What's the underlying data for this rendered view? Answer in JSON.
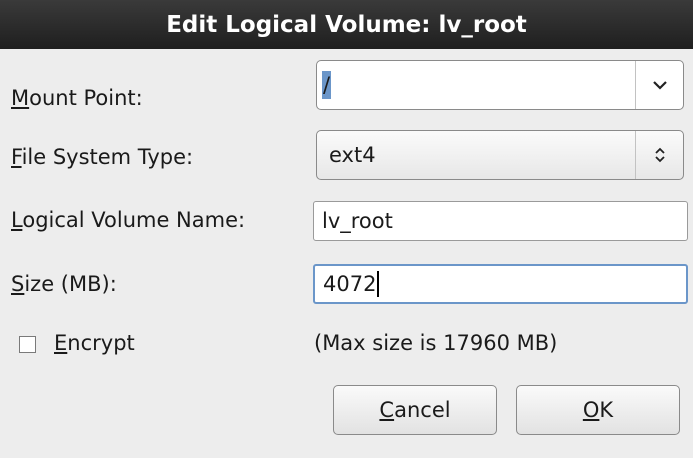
{
  "dialog": {
    "title": "Edit Logical Volume: lv_root"
  },
  "mount_point": {
    "label_accel": "M",
    "label_rest": "ount Point:",
    "value": "/"
  },
  "fs_type": {
    "label_accel": "F",
    "label_rest": "ile System Type:",
    "value": "ext4"
  },
  "lv_name": {
    "label_accel": "L",
    "label_rest": "ogical Volume Name:",
    "value": "lv_root"
  },
  "size": {
    "label_accel": "S",
    "label_rest": "ize (MB):",
    "value": "4072"
  },
  "encrypt": {
    "label_accel": "E",
    "label_rest": "ncrypt",
    "checked": false
  },
  "max_size_text": "(Max size is 17960 MB)",
  "buttons": {
    "cancel_accel": "C",
    "cancel_rest": "ancel",
    "ok_accel": "O",
    "ok_rest": "K"
  },
  "colors": {
    "title_bg": "#1f1f1f",
    "focus": "#6b96c9"
  }
}
